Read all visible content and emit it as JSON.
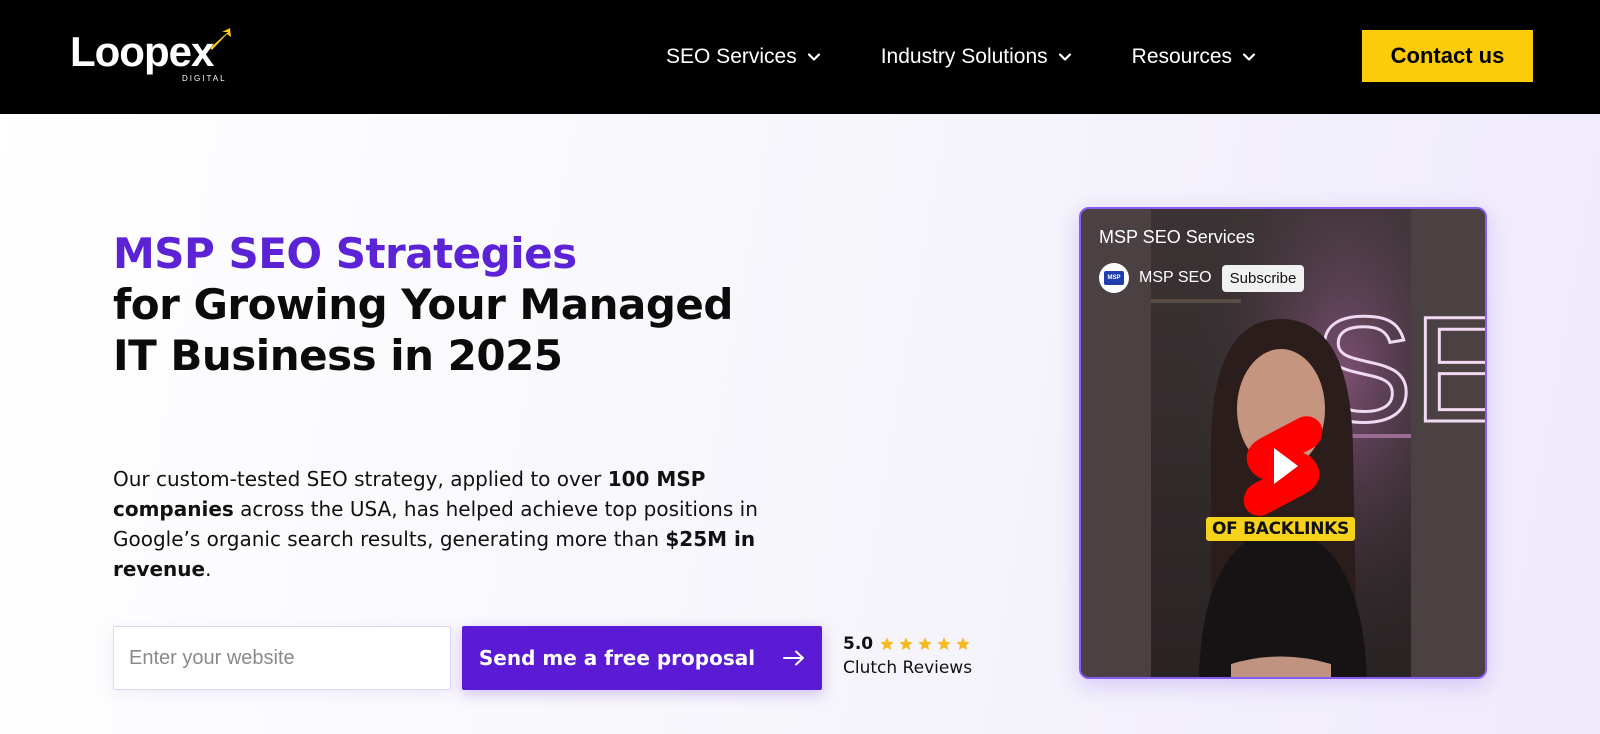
{
  "brand": {
    "logo_text": "Loopex",
    "logo_sub": "DIGITAL",
    "accent": "#5b1ad4",
    "yellow": "#fccb0a"
  },
  "nav": {
    "items": [
      {
        "label": "SEO Services",
        "icon": "chevron-down-icon"
      },
      {
        "label": "Industry Solutions",
        "icon": "chevron-down-icon"
      },
      {
        "label": "Resources",
        "icon": "chevron-down-icon"
      }
    ],
    "contact_label": "Contact us"
  },
  "hero": {
    "title_accent": "MSP SEO Strategies",
    "title_rest": "for Growing Your Managed IT Business in 2025",
    "desc_1": "Our custom-tested SEO strategy, applied to over ",
    "desc_bold_1": "100 MSP companies",
    "desc_2": " across the USA, has helped achieve top positions in Google’s organic search results, generating more than ",
    "desc_bold_2": "$25M in revenue",
    "desc_3": "."
  },
  "form": {
    "website_placeholder": "Enter your website",
    "website_value": "",
    "submit_label": "Send me a free proposal",
    "submit_icon": "arrow-right-icon"
  },
  "rating": {
    "score": "5.0",
    "stars": 5,
    "label": "Clutch Reviews"
  },
  "video": {
    "title": "MSP SEO Services",
    "channel": "MSP SEO",
    "avatar_text": "MSP",
    "subscribe_label": "Subscribe",
    "caption": "OF BACKLINKS",
    "neon_text": "SE",
    "play_icon": "youtube-shorts-play-icon"
  }
}
